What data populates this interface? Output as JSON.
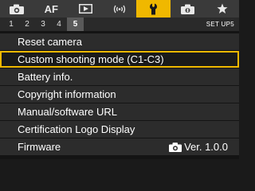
{
  "tabs": [
    {
      "icon": "camera-icon",
      "label": ""
    },
    {
      "icon": "af-icon",
      "label": "AF"
    },
    {
      "icon": "playback-icon",
      "label": ""
    },
    {
      "icon": "wireless-icon",
      "label": ""
    },
    {
      "icon": "wrench-icon",
      "label": ""
    },
    {
      "icon": "custom-camera-icon",
      "label": ""
    },
    {
      "icon": "star-icon",
      "label": ""
    }
  ],
  "active_tab": "wrench-icon",
  "pages": [
    "1",
    "2",
    "3",
    "4",
    "5"
  ],
  "active_page": "5",
  "set_label": "SET UP5",
  "menu": {
    "items": [
      {
        "label": "Reset camera"
      },
      {
        "label": "Custom shooting mode (C1-C3)"
      },
      {
        "label": "Battery info."
      },
      {
        "label": "Copyright information"
      },
      {
        "label": "Manual/software URL"
      },
      {
        "label": "Certification Logo Display"
      },
      {
        "label": "Firmware",
        "value": "Ver. 1.0.0",
        "value_icon": "camera-icon"
      }
    ],
    "selected_index": 1
  },
  "colors": {
    "accent": "#f0b800",
    "background": "#141414",
    "item_bg": "#2c2c2c",
    "tabbar_bg": "#3a3a3a"
  }
}
